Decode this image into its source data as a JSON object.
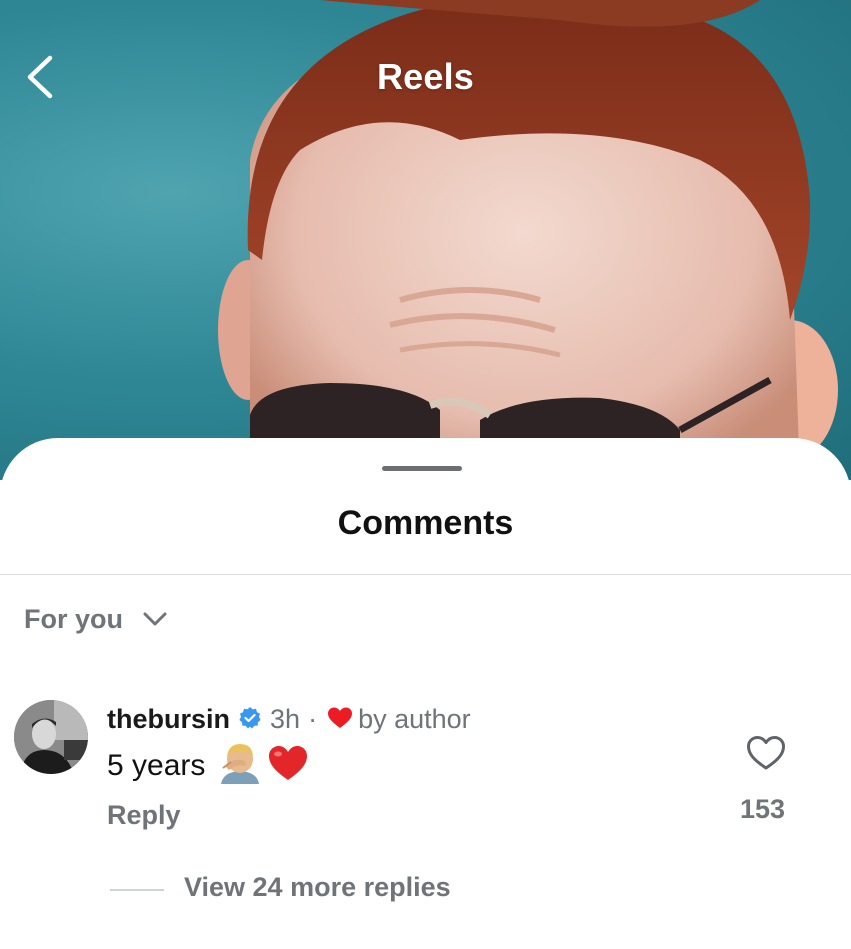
{
  "header": {
    "title": "Reels",
    "back_icon": "chevron-left-icon"
  },
  "sheet": {
    "title": "Comments",
    "sort": {
      "label": "For you",
      "icon": "chevron-down-icon"
    }
  },
  "comment": {
    "username": "thebursin",
    "verified": true,
    "timestamp": "3h",
    "separator": "·",
    "author_badge": "by author",
    "text": "5 years",
    "emojis": [
      "man-facepalming-emoji",
      "red-heart-emoji"
    ],
    "reply_label": "Reply",
    "like_count": "153",
    "view_replies_label": "View 24 more replies"
  },
  "colors": {
    "verified_blue": "#3897f0",
    "heart_red": "#ed1c24",
    "muted_text": "#6f7478",
    "backdrop_teal": "#2f8795"
  }
}
